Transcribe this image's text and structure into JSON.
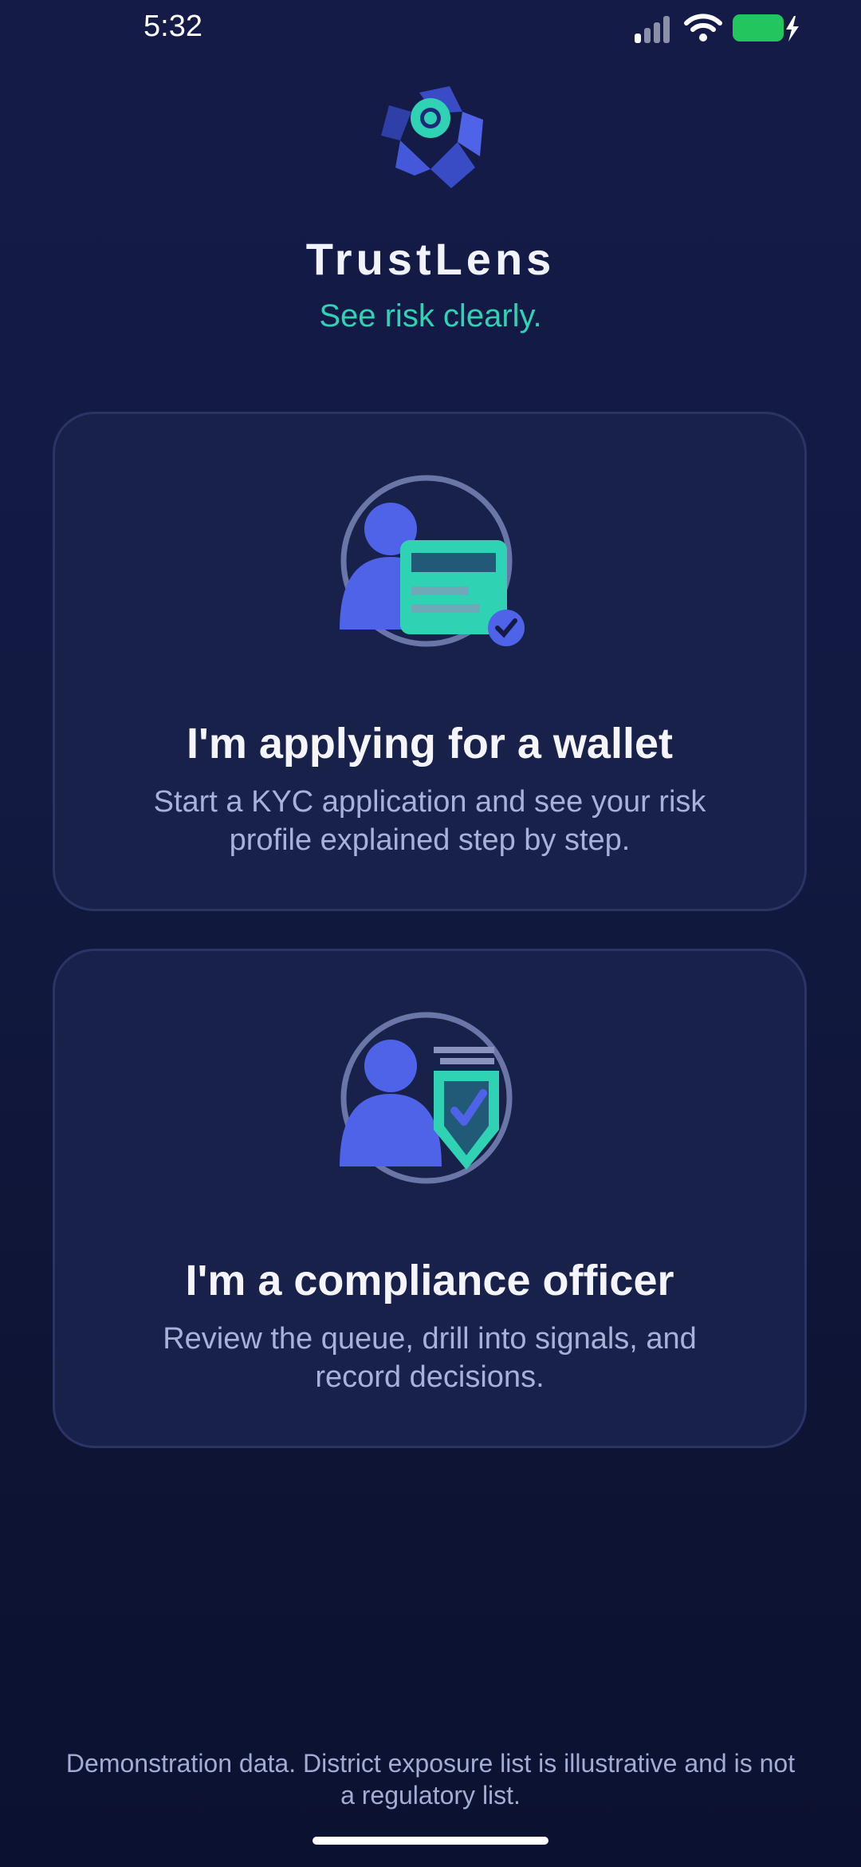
{
  "status_bar": {
    "time": "5:32",
    "icons": [
      "signal-icon",
      "wifi-icon",
      "battery-charging-icon"
    ],
    "battery_color": "#22c55e"
  },
  "header": {
    "logo": "trustlens-logo",
    "title": "TrustLens",
    "tagline": "See risk clearly."
  },
  "roles": [
    {
      "icon": "applicant-id-card-icon",
      "title": "I'm applying for a wallet",
      "description": "Start a KYC application and see your risk profile explained step by step."
    },
    {
      "icon": "officer-shield-icon",
      "title": "I'm a compliance officer",
      "description": "Review the queue, drill into signals, and record decisions."
    }
  ],
  "footer": {
    "note": "Demonstration data. District exposure list is illustrative and is not a regulatory list."
  },
  "colors": {
    "background": "#131a44",
    "card": "#18214a",
    "accent_teal": "#2fd3b3",
    "accent_blue": "#4f63e8",
    "text_muted": "#a8b1d8"
  }
}
